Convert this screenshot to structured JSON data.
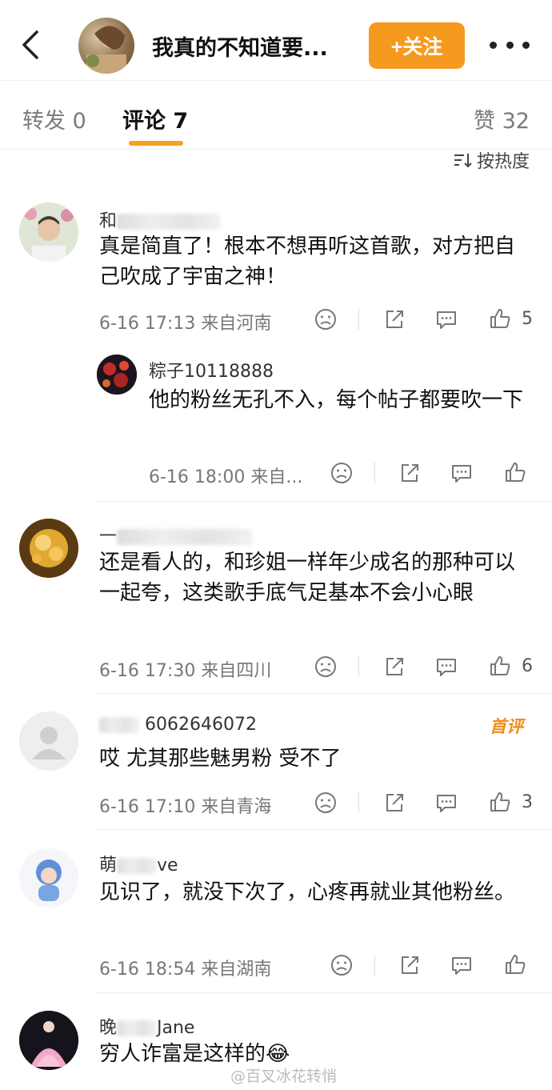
{
  "header": {
    "title": "我真的不知道要...",
    "follow_label": "+关注"
  },
  "tabs": {
    "repost": "转发 0",
    "comments": "评论 7",
    "likes": "赞 32"
  },
  "sort_label": "按热度",
  "comments": [
    {
      "username_visible": "和",
      "text": "真是简直了！根本不想再听这首歌，对方把自己吹成了宇宙之神！",
      "time": "6-16 17:13",
      "location": "来自河南",
      "likes": "5"
    },
    {
      "username_visible": "粽子10118888",
      "text": "他的粉丝无孔不入，每个帖子都要吹一下",
      "time": "6-16 18:00",
      "location": "来自..."
    },
    {
      "username_visible": "一",
      "text": "还是看人的，和珍姐一样年少成名的那种可以一起夸，这类歌手底气足基本不会小心眼",
      "time": "6-16 17:30",
      "location": "来自四川",
      "likes": "6"
    },
    {
      "username_visible": "6062646072",
      "badge": "首评",
      "text": "哎 尤其那些魅男粉 受不了",
      "time": "6-16 17:10",
      "location": "来自青海",
      "likes": "3"
    },
    {
      "username_visible": "ve",
      "text": "见识了，就没下次了，心疼再就业其他粉丝。",
      "time": "6-16 18:54",
      "location": "来自湖南"
    },
    {
      "username_visible": "Jane",
      "text": "穷人诈富是这样的😂"
    }
  ],
  "watermark": "@百叉冰花转悄"
}
